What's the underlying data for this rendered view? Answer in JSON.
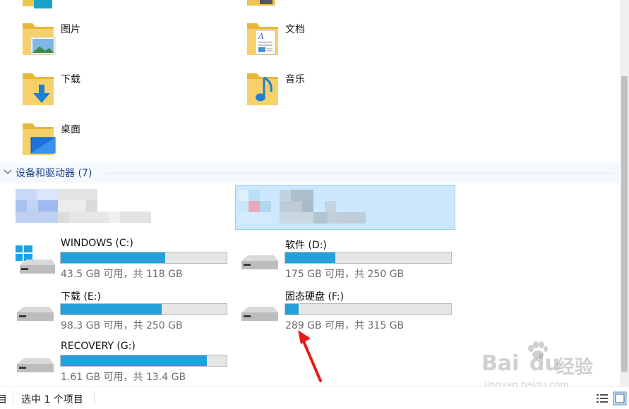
{
  "folders": [
    {
      "label": "图片",
      "icon": "pictures-folder-icon"
    },
    {
      "label": "文档",
      "icon": "documents-folder-icon"
    },
    {
      "label": "下载",
      "icon": "downloads-folder-icon"
    },
    {
      "label": "音乐",
      "icon": "music-folder-icon"
    },
    {
      "label": "桌面",
      "icon": "desktop-folder-icon"
    }
  ],
  "devices_section": {
    "title": "设备和驱动器 (7)"
  },
  "drives": [
    {
      "name": "WINDOWS (C:)",
      "info": "43.5 GB 可用，共 118 GB",
      "used_fraction": 0.63
    },
    {
      "name": "软件 (D:)",
      "info": "175 GB 可用，共 250 GB",
      "used_fraction": 0.3
    },
    {
      "name": "下载 (E:)",
      "info": "98.3 GB 可用，共 250 GB",
      "used_fraction": 0.61
    },
    {
      "name": "固态硬盘 (F:)",
      "info": "289 GB 可用，共 315 GB",
      "used_fraction": 0.08
    },
    {
      "name": "RECOVERY (G:)",
      "info": "1.61 GB 可用，共 13.4 GB",
      "used_fraction": 0.88
    }
  ],
  "status": {
    "selection": "选中 1 个项目",
    "left_partial": "目"
  },
  "watermark": {
    "brand": "Bai",
    "brand2": "du",
    "brand3": "经验",
    "url": "jingyan.baidu.com"
  },
  "colors": {
    "progress": "#26a0da",
    "section_title": "#1e3f8a",
    "selection": "#cce8ff",
    "arrow": "#e8191b"
  }
}
